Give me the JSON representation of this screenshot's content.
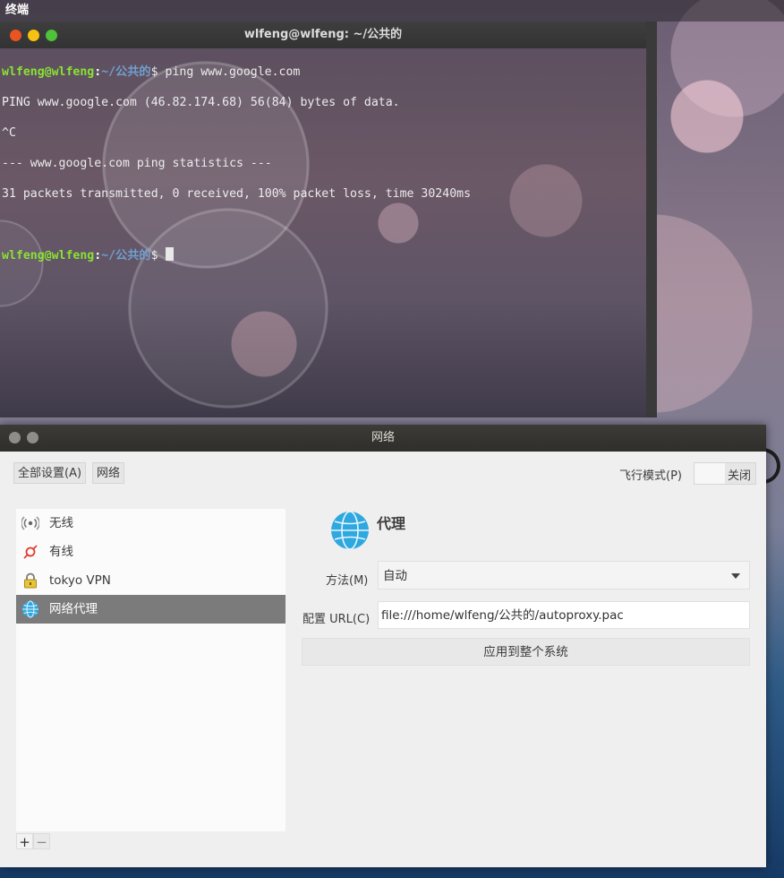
{
  "topbar": {
    "app_name": "终端"
  },
  "terminal": {
    "title": "wlfeng@wlfeng: ~/公共的",
    "lines": [
      {
        "user": "wlfeng@wlfeng",
        "path": "~/公共的",
        "prompt_char": "$ ",
        "command": "ping www.google.com"
      },
      {
        "output": "PING www.google.com (46.82.174.68) 56(84) bytes of data."
      },
      {
        "output": "^C"
      },
      {
        "output": "--- www.google.com ping statistics ---"
      },
      {
        "output": "31 packets transmitted, 0 received, 100% packet loss, time 30240ms"
      },
      {
        "output": ""
      },
      {
        "user": "wlfeng@wlfeng",
        "path": "~/公共的",
        "prompt_char": "$ ",
        "command": ""
      }
    ],
    "colors": {
      "user": "#8ae234",
      "path": "#729fcf",
      "close": "#e95420",
      "minimize": "#f5c211",
      "maximize": "#4fc13a"
    }
  },
  "network": {
    "title": "网络",
    "breadcrumb": {
      "all_settings": "全部设置(A)",
      "current": "网络"
    },
    "airplane_mode": {
      "label": "飞行模式(P)",
      "state": "关闭"
    },
    "sidebar": {
      "items": [
        {
          "icon": "wifi-icon",
          "label": "无线",
          "selected": false
        },
        {
          "icon": "wired-icon",
          "label": "有线",
          "selected": false
        },
        {
          "icon": "vpn-lock-icon",
          "label": "tokyo VPN",
          "selected": false
        },
        {
          "icon": "globe-icon",
          "label": "网络代理",
          "selected": true
        }
      ],
      "add_label": "+",
      "remove_label": "−"
    },
    "proxy": {
      "heading": "代理",
      "method_label": "方法(M)",
      "method_value": "自动",
      "config_url_label": "配置 URL(C)",
      "config_url_value": "file:///home/wlfeng/公共的/autoproxy.pac",
      "apply_label": "应用到整个系统"
    }
  }
}
